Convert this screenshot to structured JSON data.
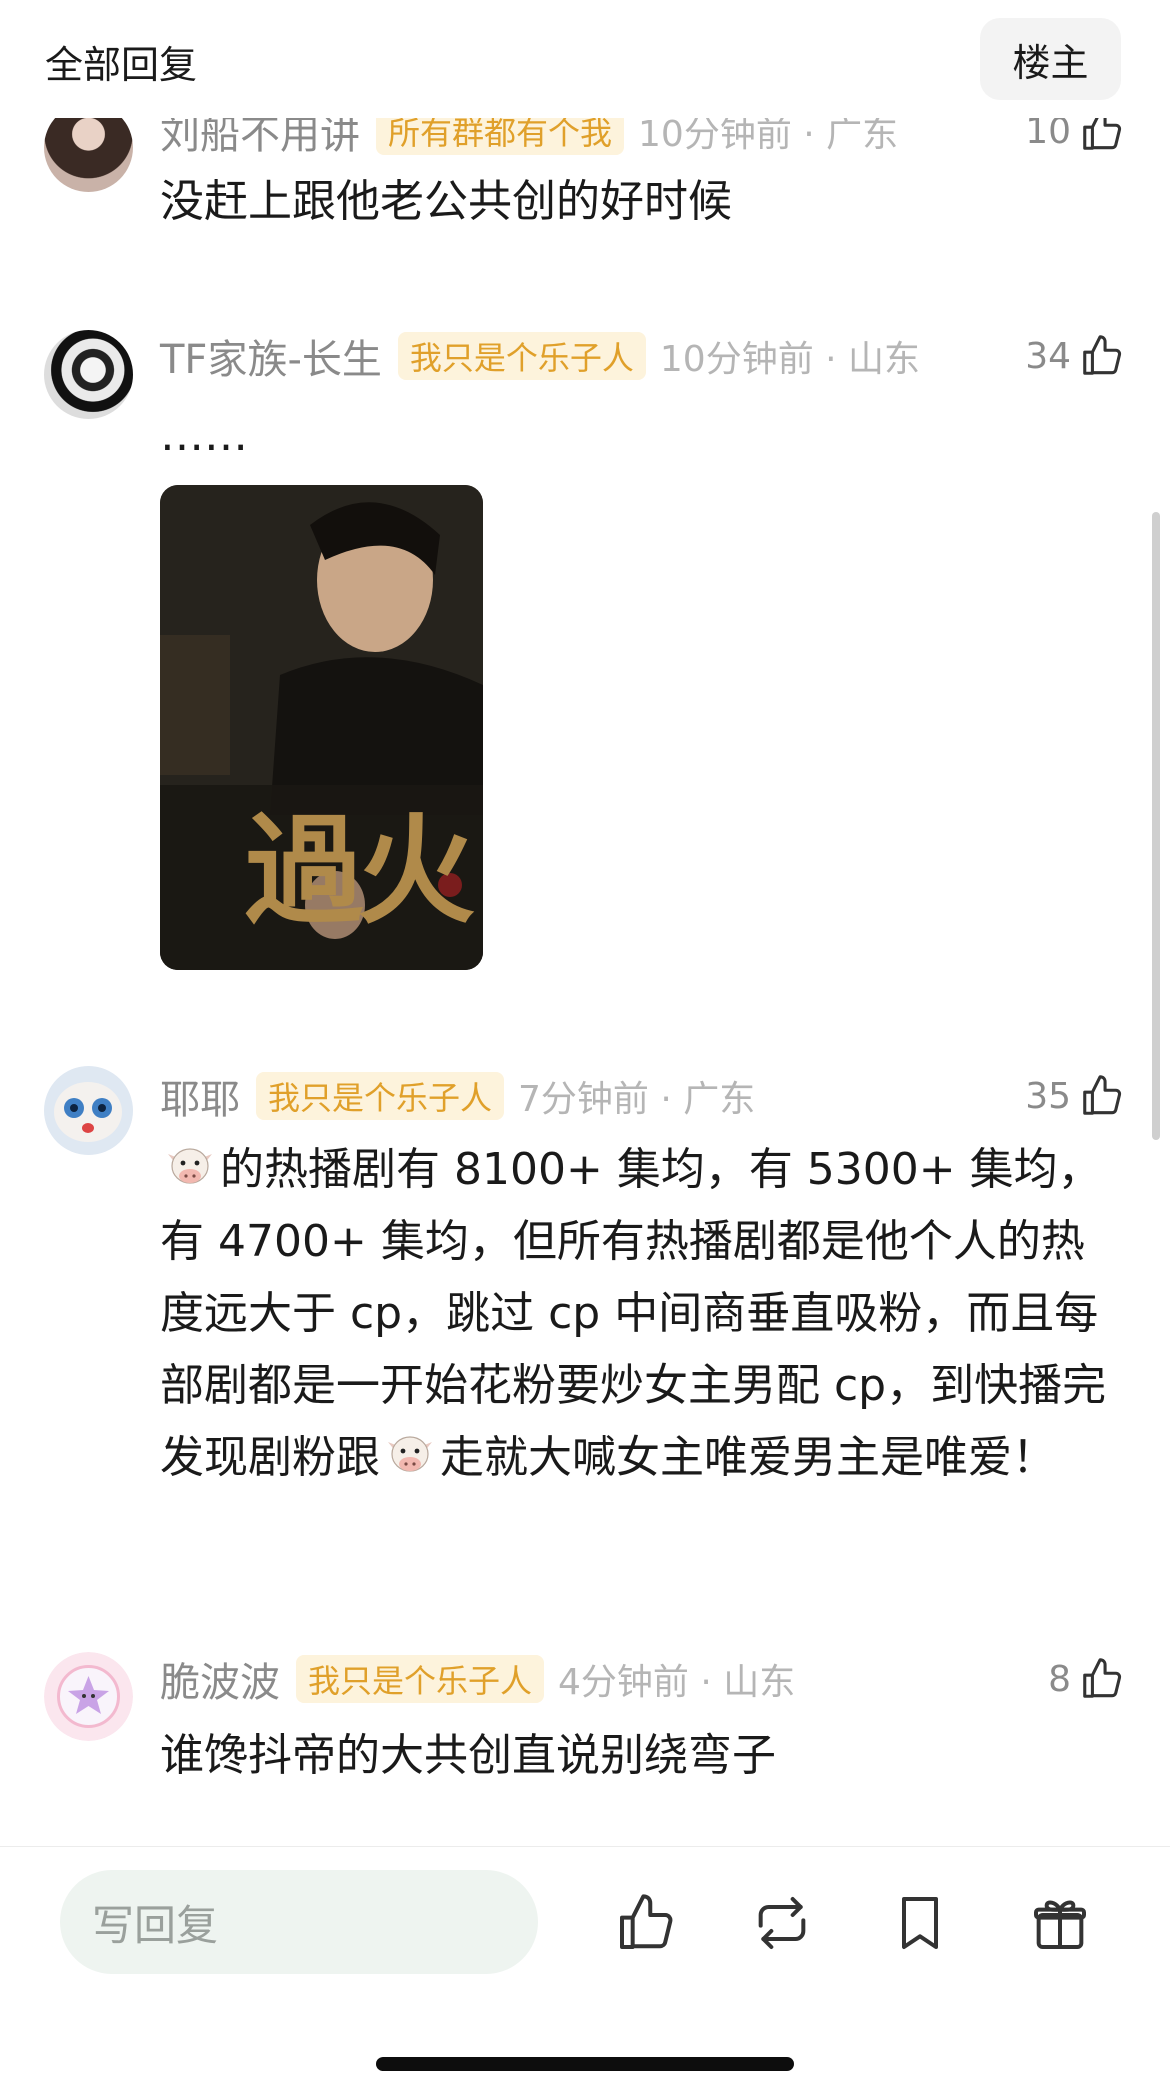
{
  "header": {
    "title": "全部回复",
    "op_button": "楼主"
  },
  "comments": [
    {
      "username": "刘船不用讲",
      "badge": "所有群都有个我",
      "time_location": "10分钟前 · 广东",
      "likes": "10",
      "text": "没赶上跟他老公共创的好时候"
    },
    {
      "username": "TF家族-长生",
      "badge": "我只是个乐子人",
      "time_location": "10分钟前 · 山东",
      "likes": "34",
      "text": "……",
      "image_title": "過火"
    },
    {
      "username": "耶耶",
      "badge": "我只是个乐子人",
      "time_location": "7分钟前 · 广东",
      "likes": "35",
      "text_parts": [
        "的热播剧有 8100+ 集均，有 5300+ 集均，有 4700+ 集均，但所有热播剧都是他个人的热度远大于 cp，跳过 cp 中间商垂直吸粉，而且每部剧都是一开始花粉要炒女主男配 cp，到快播完发现剧粉跟",
        "走就大喊女主唯爱男主是唯爱！"
      ],
      "emoji": "cow-face"
    },
    {
      "username": "脆波波",
      "badge": "我只是个乐子人",
      "time_location": "4分钟前 · 山东",
      "likes": "8",
      "text": "谁馋抖帝的大共创直说别绕弯子"
    }
  ],
  "bottom_bar": {
    "reply_placeholder": "写回复",
    "icons": [
      "thumb-up-icon",
      "repost-icon",
      "bookmark-icon",
      "gift-icon"
    ]
  },
  "colors": {
    "badge_bg": "#fdf3dc",
    "badge_text": "#e0a02a",
    "meta_text": "#8a8a8a",
    "input_bg": "#eef4f0"
  }
}
